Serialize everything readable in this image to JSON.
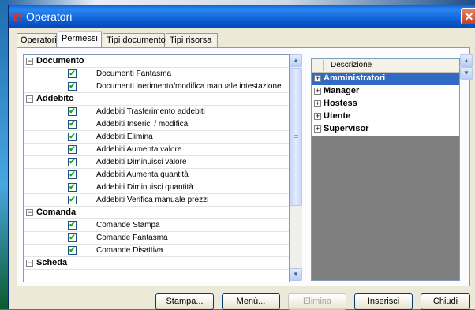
{
  "window": {
    "app_icon": "e",
    "title": "Operatori",
    "close_glyph": "✕"
  },
  "tabs": [
    "Operatori",
    "Permessi",
    "Tipi documento",
    "Tipi risorsa"
  ],
  "permissions": {
    "categories": [
      {
        "label": "Documento",
        "expander": "−",
        "items": [
          {
            "label": "Documenti Fantasma",
            "checked": true
          },
          {
            "label": "Documenti inerimento/modifica manuale intestazione",
            "checked": true
          }
        ]
      },
      {
        "label": "Addebito",
        "expander": "−",
        "items": [
          {
            "label": "Addebiti Trasferimento addebiti",
            "checked": true
          },
          {
            "label": "Addebiti Inserici / modifica",
            "checked": true
          },
          {
            "label": "Addebiti Elimina",
            "checked": true
          },
          {
            "label": "Addebiti Aumenta valore",
            "checked": true
          },
          {
            "label": "Addebiti Diminuisci valore",
            "checked": true
          },
          {
            "label": "Addebiti Aumenta quantità",
            "checked": true
          },
          {
            "label": "Addebiti Diminuisci quantità",
            "checked": true
          },
          {
            "label": "Addebiti Verifica manuale prezzi",
            "checked": true
          }
        ]
      },
      {
        "label": "Comanda",
        "expander": "−",
        "items": [
          {
            "label": "Comande Stampa",
            "checked": true
          },
          {
            "label": "Comande Fantasma",
            "checked": true
          },
          {
            "label": "Comande Disattiva",
            "checked": true
          }
        ]
      },
      {
        "label": "Scheda",
        "expander": "−",
        "items": []
      }
    ],
    "check_glyph": "✔",
    "scroll_up": "▲",
    "scroll_down": "▼"
  },
  "groups": {
    "header": "Descrizione",
    "expander": "+",
    "items": [
      "Amministratori",
      "Manager",
      "Hostess",
      "Utente",
      "Supervisor"
    ],
    "selected_index": 0
  },
  "buttons": [
    {
      "label": "Stampa...",
      "enabled": true
    },
    {
      "label": "Menù...",
      "enabled": true
    },
    {
      "label": "Elimina",
      "enabled": false
    },
    {
      "label": "Inserisci",
      "enabled": true
    },
    {
      "label": "Chiudi",
      "enabled": true
    }
  ],
  "colors": {
    "titlebar": "#0a5bd0",
    "selection": "#316ac5",
    "active_tab_accent": "#ffc83c",
    "close_button": "#c8401e"
  }
}
